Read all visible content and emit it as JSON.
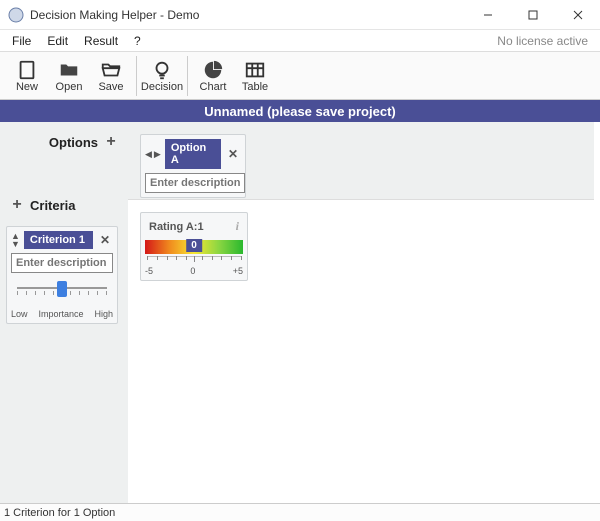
{
  "window": {
    "title": "Decision Making Helper - Demo",
    "license": "No license active"
  },
  "menu": {
    "file": "File",
    "edit": "Edit",
    "result": "Result",
    "help": "?"
  },
  "toolbar": {
    "new": "New",
    "open": "Open",
    "save": "Save",
    "decision": "Decision",
    "chart": "Chart",
    "table": "Table"
  },
  "banner": "Unnamed (please save project)",
  "labels": {
    "options": "Options",
    "criteria": "Criteria"
  },
  "option": {
    "title": "Option A",
    "placeholder": "Enter description ..."
  },
  "criterion": {
    "title": "Criterion 1",
    "placeholder": "Enter description ...",
    "low": "Low",
    "importance": "Importance",
    "high": "High"
  },
  "rating": {
    "title": "Rating A:1",
    "value": "0",
    "min": "-5",
    "mid": "0",
    "max": "+5"
  },
  "status": "1 Criterion for 1 Option"
}
